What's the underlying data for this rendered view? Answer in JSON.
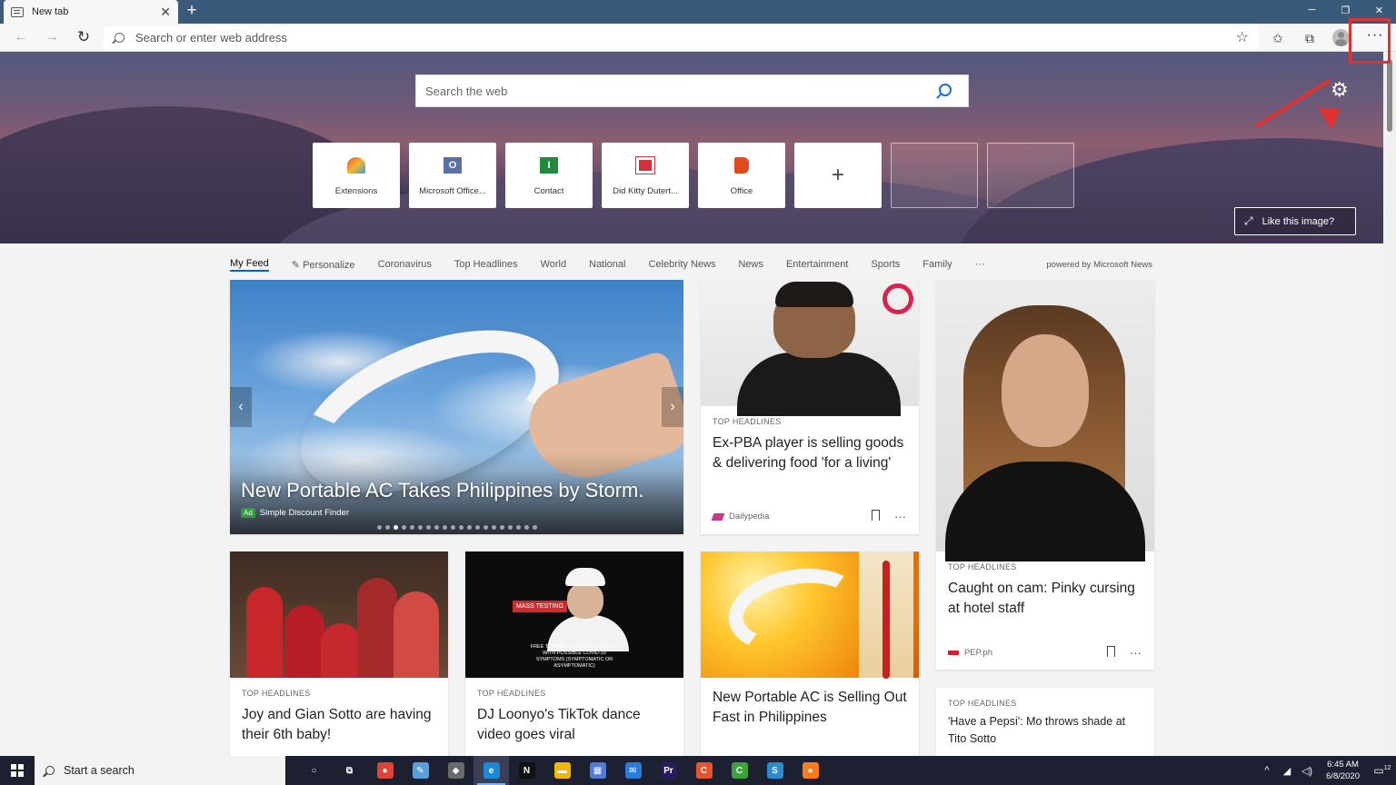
{
  "browser": {
    "tab_title": "New tab",
    "tab_close": "✕",
    "new_tab": "+",
    "address_placeholder": "Search or enter web address",
    "more_label": "···",
    "window_controls": [
      "─",
      "❐",
      "✕"
    ]
  },
  "hero": {
    "search_placeholder": "Search the web",
    "like_image": "Like this image?",
    "add_tile": "+"
  },
  "tiles": [
    {
      "label": "Extensions",
      "color": "#e84e3c",
      "icon": "extensions-icon"
    },
    {
      "label": "Microsoft Office...",
      "color": "#5b6fa8",
      "letter": "O",
      "icon": "outlook-icon"
    },
    {
      "label": "Contact",
      "color": "#218a3c",
      "letter": "I",
      "icon": "contact-icon"
    },
    {
      "label": "Did Kitty Dutert...",
      "color": "#d3303a",
      "icon": "news-icon"
    },
    {
      "label": "Office",
      "color": "#e2491b",
      "icon": "office-icon"
    }
  ],
  "feed_nav": {
    "items": [
      "My Feed",
      "Personalize",
      "Coronavirus",
      "Top Headlines",
      "World",
      "National",
      "Celebrity News",
      "News",
      "Entertainment",
      "Sports",
      "Family",
      "···"
    ],
    "powered": "powered by Microsoft News"
  },
  "featured": {
    "title": "New Portable AC Takes Philippines by Storm.",
    "ad_badge": "Ad",
    "source": "Simple Discount Finder",
    "prev": "‹",
    "next": "›",
    "dot_count": 20,
    "active_dot": 2
  },
  "cards": {
    "c1": {
      "category": "TOP HEADLINES",
      "headline": "Ex-PBA player is selling goods & delivering food 'for a living'",
      "source": "Dailypedia",
      "more": "···"
    },
    "c2": {
      "category": "TOP HEADLINES",
      "headline": "Caught on cam: Pinky cursing at hotel staff",
      "source": "PEP.ph",
      "more": "···"
    },
    "c3": {
      "category": "TOP HEADLINES",
      "headline": "Joy and Gian Sotto are having their 6th baby!"
    },
    "c4": {
      "category": "TOP HEADLINES",
      "headline": "DJ Loonyo's TikTok dance video goes viral",
      "badge": "MASS TESTING",
      "caption": "FREE TESTING TO ISOLATE PEOPLE WITH POSSIBLE COVID-19 SYMPTOMS (SYMPTOMATIC OR ASYMPTOMATIC)"
    },
    "c5": {
      "headline": "New Portable AC is Selling Out Fast in Philippines"
    },
    "c6": {
      "category": "TOP HEADLINES",
      "headline": "'Have a Pepsi': Mo throws shade at Tito Sotto"
    }
  },
  "taskbar": {
    "search_placeholder": "Start a search",
    "apps": [
      {
        "name": "cortana-icon",
        "glyph": "○",
        "color": "transparent"
      },
      {
        "name": "task-view-icon",
        "glyph": "⧉",
        "color": "transparent"
      },
      {
        "name": "chrome-icon",
        "glyph": "●",
        "color": "#db4437"
      },
      {
        "name": "notepad-icon",
        "glyph": "✎",
        "color": "#5aa0d8"
      },
      {
        "name": "game-controller-icon",
        "glyph": "◆",
        "color": "#6a6a6a"
      },
      {
        "name": "edge-icon",
        "glyph": "e",
        "color": "#1e88d2",
        "active": true
      },
      {
        "name": "netflix-icon",
        "glyph": "N",
        "color": "#111111"
      },
      {
        "name": "file-explorer-icon",
        "glyph": "▬",
        "color": "#f2b705"
      },
      {
        "name": "store-icon",
        "glyph": "▦",
        "color": "#4f7cd6"
      },
      {
        "name": "mail-icon",
        "glyph": "✉",
        "color": "#2a7bd6"
      },
      {
        "name": "premiere-icon",
        "glyph": "Pr",
        "color": "#2a1a5e"
      },
      {
        "name": "camtasia-icon",
        "glyph": "C",
        "color": "#e9532a"
      },
      {
        "name": "camtasia-green-icon",
        "glyph": "C",
        "color": "#3ca33c"
      },
      {
        "name": "snagit-icon",
        "glyph": "S",
        "color": "#2a8bd0"
      },
      {
        "name": "firefox-icon",
        "glyph": "●",
        "color": "#ff7a1a"
      }
    ],
    "time": "6:45 AM",
    "date": "6/8/2020",
    "notification_count": "12"
  }
}
